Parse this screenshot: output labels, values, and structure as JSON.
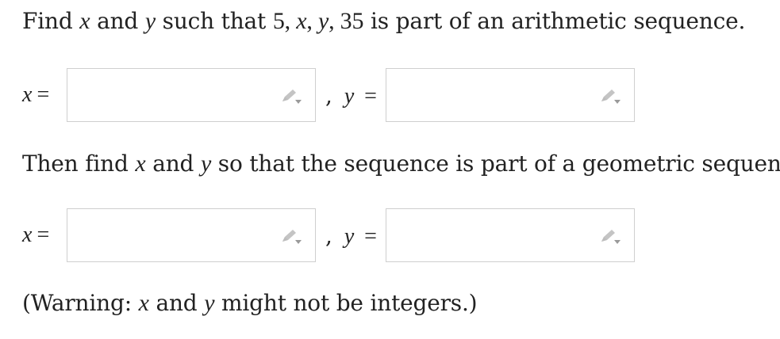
{
  "question": {
    "part1": {
      "t1": "Find ",
      "x": "x",
      "t2": " and ",
      "y": "y",
      "t3": " such that ",
      "seq": "5, ",
      "seq_x": "x",
      "seq_c1": ", ",
      "seq_y": "y",
      "seq_end": ", 35",
      "t4": " is part of an arithmetic sequence."
    },
    "part2": {
      "t1": "Then find ",
      "x": "x",
      "t2": " and ",
      "y": "y",
      "t3": " so that the sequence is part of a geometric sequence."
    },
    "warning": {
      "t1": "(Warning: ",
      "x": "x",
      "t2": " and ",
      "y": "y",
      "t3": " might not be integers.)"
    }
  },
  "answers": {
    "arith_x": {
      "label": "x",
      "eq": "=",
      "value": ""
    },
    "arith_y": {
      "label": "y",
      "eq": "=",
      "value": ""
    },
    "geo_x": {
      "label": "x",
      "eq": "=",
      "value": ""
    },
    "geo_y": {
      "label": "y",
      "eq": "=",
      "value": ""
    },
    "separator": ","
  },
  "icons": {
    "edit": "pencil-icon",
    "color": "#c4c4c4"
  }
}
